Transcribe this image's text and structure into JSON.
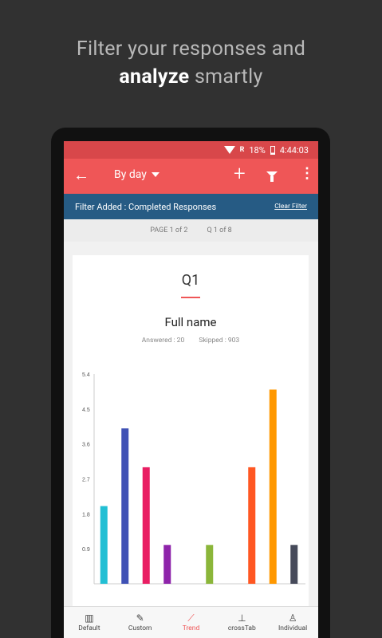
{
  "promo": {
    "line1": "Filter your responses and",
    "line2_strong": "analyze",
    "line2_rest": " smartly"
  },
  "status": {
    "network": "R",
    "battery": "18%",
    "time": "4:44:03"
  },
  "appbar": {
    "title": "By day"
  },
  "filter": {
    "text": "Filter Added : Completed Responses",
    "clear": "Clear Filter"
  },
  "pager": {
    "page": "PAGE 1 of 2",
    "question": "Q 1 of 8"
  },
  "card": {
    "qnum": "Q1",
    "title": "Full name",
    "answered": "Answered : 20",
    "skipped": "Skipped : 903"
  },
  "nav": [
    {
      "label": "Default",
      "icon": "bar-chart-icon"
    },
    {
      "label": "Custom",
      "icon": "edit-icon"
    },
    {
      "label": "Trend",
      "icon": "trend-icon",
      "active": true
    },
    {
      "label": "crossTab",
      "icon": "crosstab-icon"
    },
    {
      "label": "Individual",
      "icon": "person-icon"
    }
  ],
  "chart_data": {
    "type": "bar",
    "ylim": [
      0,
      5.4
    ],
    "yticks": [
      "5.4",
      "4.5",
      "3.6",
      "2.7",
      "1.8",
      "0.9"
    ],
    "values": [
      2,
      4,
      3,
      1,
      0,
      1,
      0,
      3,
      5,
      1
    ],
    "colors": [
      "#22bfd4",
      "#3f51b5",
      "#e91e63",
      "#8e24aa",
      "#ffffff",
      "#8bb63a",
      "#ffffff",
      "#ff5722",
      "#ff9800",
      "#464a5a"
    ]
  }
}
